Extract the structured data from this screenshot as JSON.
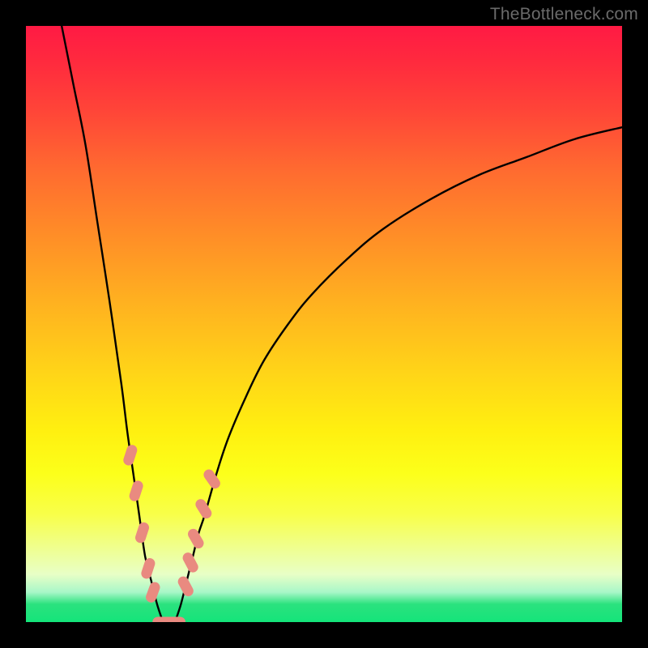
{
  "watermark": "TheBottleneck.com",
  "chart_data": {
    "type": "line",
    "title": "",
    "xlabel": "",
    "ylabel": "",
    "xlim": [
      0,
      100
    ],
    "ylim": [
      0,
      100
    ],
    "series": [
      {
        "name": "left-branch",
        "x": [
          6,
          8,
          10,
          12,
          14,
          16,
          17,
          18,
          19,
          20,
          21,
          22,
          23
        ],
        "values": [
          100,
          90,
          80,
          67,
          54,
          40,
          32,
          25,
          18,
          11,
          7,
          3,
          0
        ]
      },
      {
        "name": "right-branch",
        "x": [
          25,
          26,
          27,
          28,
          29,
          30,
          32,
          34,
          37,
          40,
          44,
          48,
          54,
          60,
          68,
          76,
          84,
          92,
          100
        ],
        "values": [
          0,
          3,
          7,
          11,
          15,
          18,
          25,
          31,
          38,
          44,
          50,
          55,
          61,
          66,
          71,
          75,
          78,
          81,
          83
        ]
      }
    ],
    "flat_segment": {
      "x": [
        23,
        25
      ],
      "value": 0
    },
    "markers": [
      {
        "branch": "left",
        "x": 17.5,
        "y": 28,
        "angle": -72
      },
      {
        "branch": "left",
        "x": 18.5,
        "y": 22,
        "angle": -72
      },
      {
        "branch": "left",
        "x": 19.5,
        "y": 15,
        "angle": -72
      },
      {
        "branch": "left",
        "x": 20.5,
        "y": 9,
        "angle": -72
      },
      {
        "branch": "left",
        "x": 21.3,
        "y": 5,
        "angle": -70
      },
      {
        "branch": "flat",
        "x": 23.0,
        "y": 0,
        "angle": 0
      },
      {
        "branch": "flat",
        "x": 25.0,
        "y": 0,
        "angle": 0
      },
      {
        "branch": "right",
        "x": 26.8,
        "y": 6,
        "angle": 62
      },
      {
        "branch": "right",
        "x": 27.6,
        "y": 10,
        "angle": 62
      },
      {
        "branch": "right",
        "x": 28.5,
        "y": 14,
        "angle": 60
      },
      {
        "branch": "right",
        "x": 29.8,
        "y": 19,
        "angle": 58
      },
      {
        "branch": "right",
        "x": 31.2,
        "y": 24,
        "angle": 55
      }
    ],
    "gradient_stops": [
      {
        "pos": 0,
        "color": "#ff1a44"
      },
      {
        "pos": 24,
        "color": "#ff6a30"
      },
      {
        "pos": 58,
        "color": "#ffd418"
      },
      {
        "pos": 82,
        "color": "#f8ff4a"
      },
      {
        "pos": 97,
        "color": "#2be27e"
      },
      {
        "pos": 100,
        "color": "#14e47a"
      }
    ]
  }
}
